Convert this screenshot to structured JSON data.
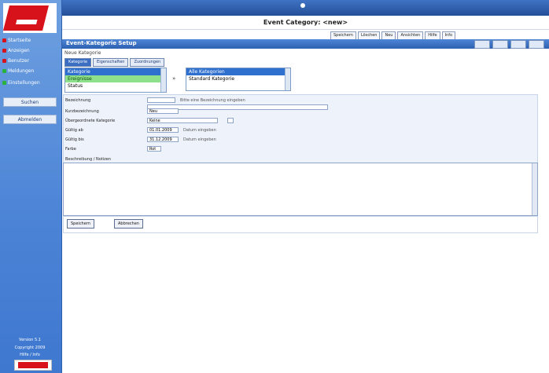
{
  "header": {
    "title": "Event Category: <new>",
    "toolbar": [
      "Speichern",
      "Löschen",
      "Neu",
      "Ansichten",
      "Hilfe",
      "Info"
    ]
  },
  "section": {
    "title": "Event-Kategorie Setup",
    "note": "Neue Kategorie",
    "tabs": [
      "Kategorie",
      "Eigenschaften",
      "Zuordnungen"
    ]
  },
  "lists": {
    "left": [
      "Kategorie",
      "Ereignisse",
      "Status"
    ],
    "right": [
      "Alle Kategorien",
      "Standard Kategorie"
    ],
    "arrow": "»"
  },
  "sidebar": {
    "items": [
      "Startseite",
      "Anzeigen",
      "Benutzer",
      "Meldungen",
      "Einstellungen"
    ],
    "buttons": [
      "Suchen",
      "Abmelden"
    ],
    "footer": [
      "Version 5.1",
      "Copyright 2009",
      "Hilfe / Info"
    ]
  },
  "form": {
    "fields": [
      {
        "label": "Bezeichnung",
        "value": "",
        "hint": "Bitte eine Bezeichnung eingeben"
      },
      {
        "label": "Kurzbezeichnung",
        "value": "Neu",
        "hint": ""
      },
      {
        "label": "Übergeordnete Kategorie",
        "value": "Keine",
        "hint": ""
      },
      {
        "label": "Gültig ab",
        "value": "01.01.2009",
        "hint": "Datum eingeben"
      },
      {
        "label": "Gültig bis",
        "value": "31.12.2009",
        "hint": "Datum eingeben"
      },
      {
        "label": "Farbe",
        "value": "Rot",
        "hint": ""
      }
    ],
    "description_label": "Beschreibung / Notizen"
  },
  "actions": {
    "save": "Speichern",
    "cancel": "Abbrechen"
  }
}
